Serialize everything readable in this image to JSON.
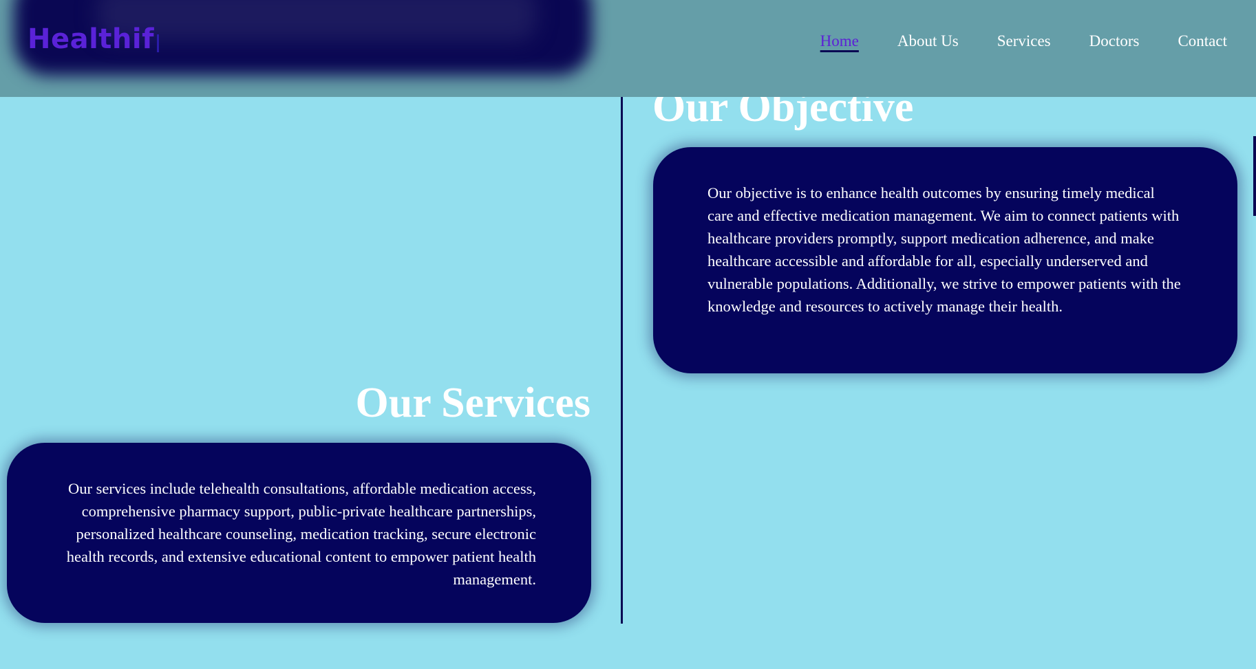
{
  "header": {
    "logo_text": "Healthif",
    "nav": [
      {
        "label": "Home",
        "active": true
      },
      {
        "label": "About Us",
        "active": false
      },
      {
        "label": "Services",
        "active": false
      },
      {
        "label": "Doctors",
        "active": false
      },
      {
        "label": "Contact",
        "active": false
      }
    ]
  },
  "objective": {
    "title": "Our Objective",
    "text": "Our objective is to enhance health outcomes by ensuring timely medical care and effective medication management. We aim to connect patients with healthcare providers promptly, support medication adherence, and make healthcare accessible and affordable for all, especially underserved and vulnerable populations. Additionally, we strive to empower patients with the knowledge and resources to actively manage their health."
  },
  "services": {
    "title": "Our Services",
    "text": "Our services include telehealth consultations, affordable medication access, comprehensive pharmacy support, public-private healthcare partnerships, personalized healthcare counseling, medication tracking, secure electronic health records, and extensive educational content to empower patient health management."
  },
  "colors": {
    "page_background": "#93dfee",
    "header_background": "#659ea8",
    "card_background": "#05045c",
    "logo": "#5a22d8",
    "active_nav": "#5c20d6",
    "timeline": "#0a0753"
  }
}
